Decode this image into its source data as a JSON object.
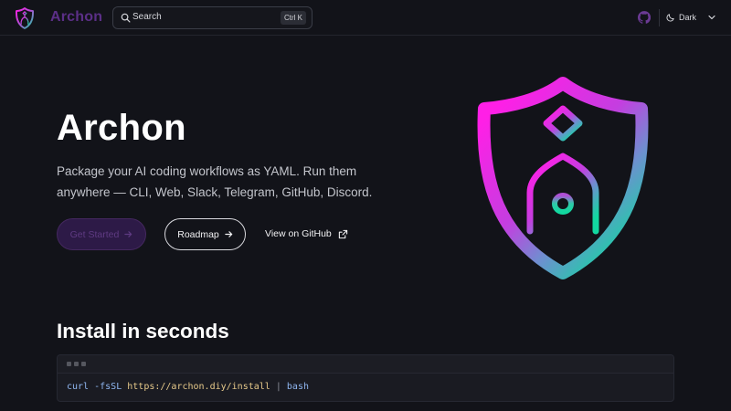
{
  "nav": {
    "brand": "Archon",
    "search": {
      "placeholder": "Search",
      "shortcut": "Ctrl K"
    },
    "github_icon": "github-icon",
    "theme": {
      "label": "Dark",
      "icon": "moon-icon"
    }
  },
  "hero": {
    "title": "Archon",
    "description": "Package your AI coding workflows as YAML. Run them anywhere — CLI, Web, Slack, Telegram, GitHub, Discord.",
    "buttons": {
      "get_started": "Get Started",
      "roadmap": "Roadmap",
      "github": "View on GitHub"
    }
  },
  "install": {
    "title": "Install in seconds",
    "code": {
      "cmd": "curl",
      "flag": "-fsSL",
      "url": "https://archon.diy/install",
      "pipe": "|",
      "shell": "bash"
    }
  },
  "colors": {
    "background": "#121319",
    "gradient_start": "#ff1fe6",
    "gradient_mid": "#b04fd6",
    "gradient_end": "#12d8a0",
    "primary_button": "#2d1a47"
  }
}
